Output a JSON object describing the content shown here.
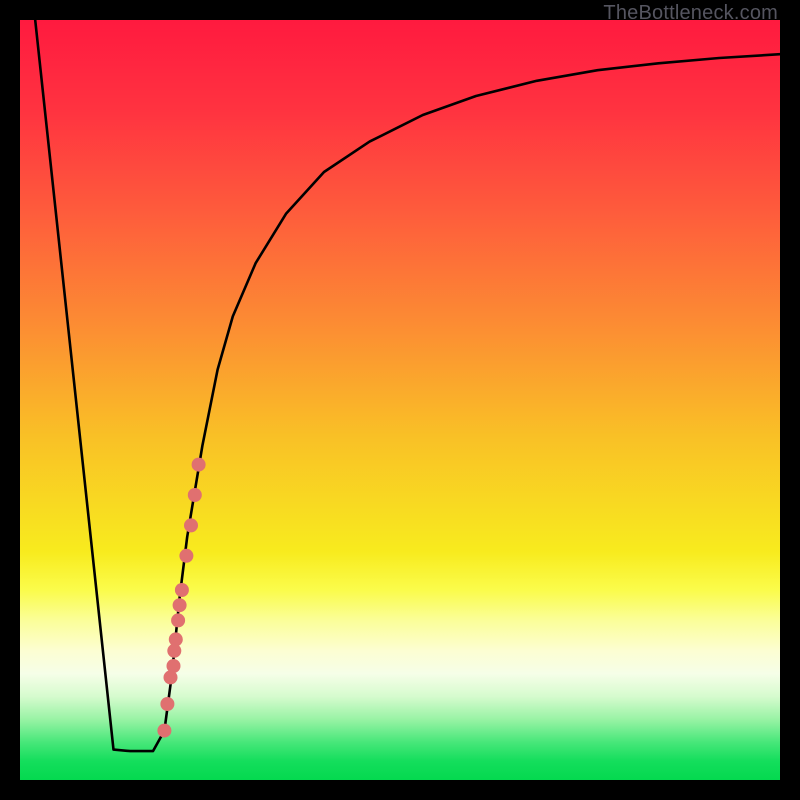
{
  "watermark": "TheBottleneck.com",
  "chart_data": {
    "type": "line",
    "title": "",
    "xlabel": "",
    "ylabel": "",
    "xlim": [
      0,
      100
    ],
    "ylim": [
      0,
      100
    ],
    "grid": false,
    "legend": false,
    "gradient_colors": [
      {
        "stop": 0.0,
        "hex": "#FF1A3F"
      },
      {
        "stop": 0.12,
        "hex": "#FF3340"
      },
      {
        "stop": 0.25,
        "hex": "#FE5B3C"
      },
      {
        "stop": 0.4,
        "hex": "#FC8C33"
      },
      {
        "stop": 0.55,
        "hex": "#F9C126"
      },
      {
        "stop": 0.7,
        "hex": "#F8EB1E"
      },
      {
        "stop": 0.75,
        "hex": "#FAFC4B"
      },
      {
        "stop": 0.79,
        "hex": "#FBFE99"
      },
      {
        "stop": 0.83,
        "hex": "#FCFED2"
      },
      {
        "stop": 0.86,
        "hex": "#F6FEE8"
      },
      {
        "stop": 0.89,
        "hex": "#D6FBCE"
      },
      {
        "stop": 0.92,
        "hex": "#99F3A5"
      },
      {
        "stop": 0.95,
        "hex": "#48E77A"
      },
      {
        "stop": 0.975,
        "hex": "#14DE5C"
      },
      {
        "stop": 1.0,
        "hex": "#04D94F"
      }
    ],
    "series": [
      {
        "name": "bottleneck-curve",
        "color": "#000000",
        "x": [
          2,
          12.3,
          14.5,
          17.5,
          19,
          20,
          21,
          22,
          24,
          26,
          28,
          31,
          35,
          40,
          46,
          53,
          60,
          68,
          76,
          84,
          92,
          100
        ],
        "y": [
          100,
          4.0,
          3.8,
          3.8,
          6.5,
          14,
          24,
          32,
          44,
          54,
          61,
          68,
          74.5,
          80,
          84,
          87.5,
          90,
          92,
          93.4,
          94.3,
          95,
          95.5
        ]
      }
    ],
    "dots": {
      "name": "highlight-dots",
      "color": "#E07070",
      "radius_px": 7,
      "x": [
        19.0,
        19.4,
        19.8,
        20.3,
        20.8,
        21.3,
        21.9,
        22.5,
        23.0,
        23.5,
        20.2,
        20.5,
        21.0
      ],
      "y": [
        6.5,
        10.0,
        13.5,
        17.0,
        21.0,
        25.0,
        29.5,
        33.5,
        37.5,
        41.5,
        15.0,
        18.5,
        23.0
      ]
    }
  }
}
